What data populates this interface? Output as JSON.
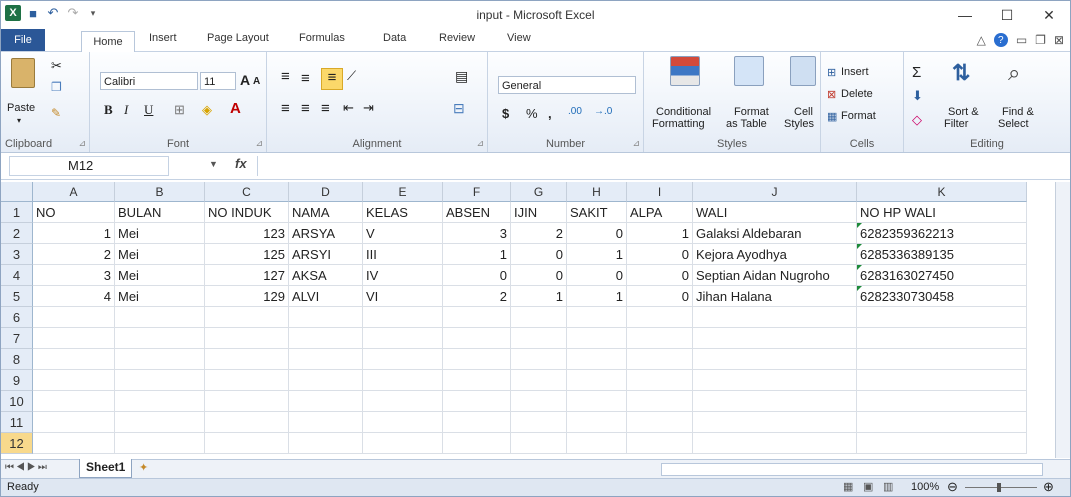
{
  "window": {
    "title": "input - Microsoft Excel",
    "min": "—",
    "max": "☐",
    "close": "✕"
  },
  "tabs": [
    "File",
    "Home",
    "Insert",
    "Page Layout",
    "Formulas",
    "Data",
    "Review",
    "View"
  ],
  "ribbon": {
    "clipboard": {
      "label": "Clipboard",
      "paste": "Paste"
    },
    "font": {
      "label": "Font",
      "name": "Calibri",
      "size": "11",
      "grow": "A",
      "shrink": "A",
      "bold": "B",
      "italic": "I",
      "underline": "U"
    },
    "alignment": {
      "label": "Alignment"
    },
    "number": {
      "label": "Number",
      "format": "General",
      "currency": "$",
      "percent": "%",
      "comma": ",",
      "inc_dec": ".00"
    },
    "styles": {
      "label": "Styles",
      "cond1": "Conditional",
      "cond2": "Formatting",
      "format_table1": "Format",
      "format_table2": "as Table",
      "cell_styles1": "Cell",
      "cell_styles2": "Styles"
    },
    "cells": {
      "label": "Cells",
      "insert": "Insert",
      "delete": "Delete",
      "format": "Format"
    },
    "editing": {
      "label": "Editing",
      "sort1": "Sort &",
      "sort2": "Filter",
      "find1": "Find &",
      "find2": "Select"
    }
  },
  "formula_bar": {
    "name_box": "M12",
    "fx": "fx",
    "content": ""
  },
  "columns": [
    "A",
    "B",
    "C",
    "D",
    "E",
    "F",
    "G",
    "H",
    "I",
    "J",
    "K"
  ],
  "rows": [
    "1",
    "2",
    "3",
    "4",
    "5",
    "6",
    "7",
    "8",
    "9",
    "10",
    "11",
    "12"
  ],
  "table": {
    "headers": [
      "NO",
      "BULAN",
      "NO INDUK",
      "NAMA",
      "KELAS",
      "ABSEN",
      "IJIN",
      "SAKIT",
      "ALPA",
      "WALI",
      "NO HP WALI"
    ],
    "data": [
      [
        "1",
        "Mei",
        "123",
        "ARSYA",
        "V",
        "3",
        "2",
        "0",
        "1",
        "Galaksi Aldebaran",
        "6282359362213"
      ],
      [
        "2",
        "Mei",
        "125",
        "ARSYI",
        "III",
        "1",
        "0",
        "1",
        "0",
        "Kejora Ayodhya",
        "6285336389135"
      ],
      [
        "3",
        "Mei",
        "127",
        "AKSA",
        "IV",
        "0",
        "0",
        "0",
        "0",
        "Septian Aidan Nugroho",
        "6283163027450"
      ],
      [
        "4",
        "Mei",
        "129",
        "ALVI",
        "VI",
        "2",
        "1",
        "1",
        "0",
        "Jihan Halana",
        "6282330730458"
      ]
    ]
  },
  "sheet_tab": "Sheet1",
  "status": {
    "ready": "Ready",
    "zoom": "100%"
  }
}
